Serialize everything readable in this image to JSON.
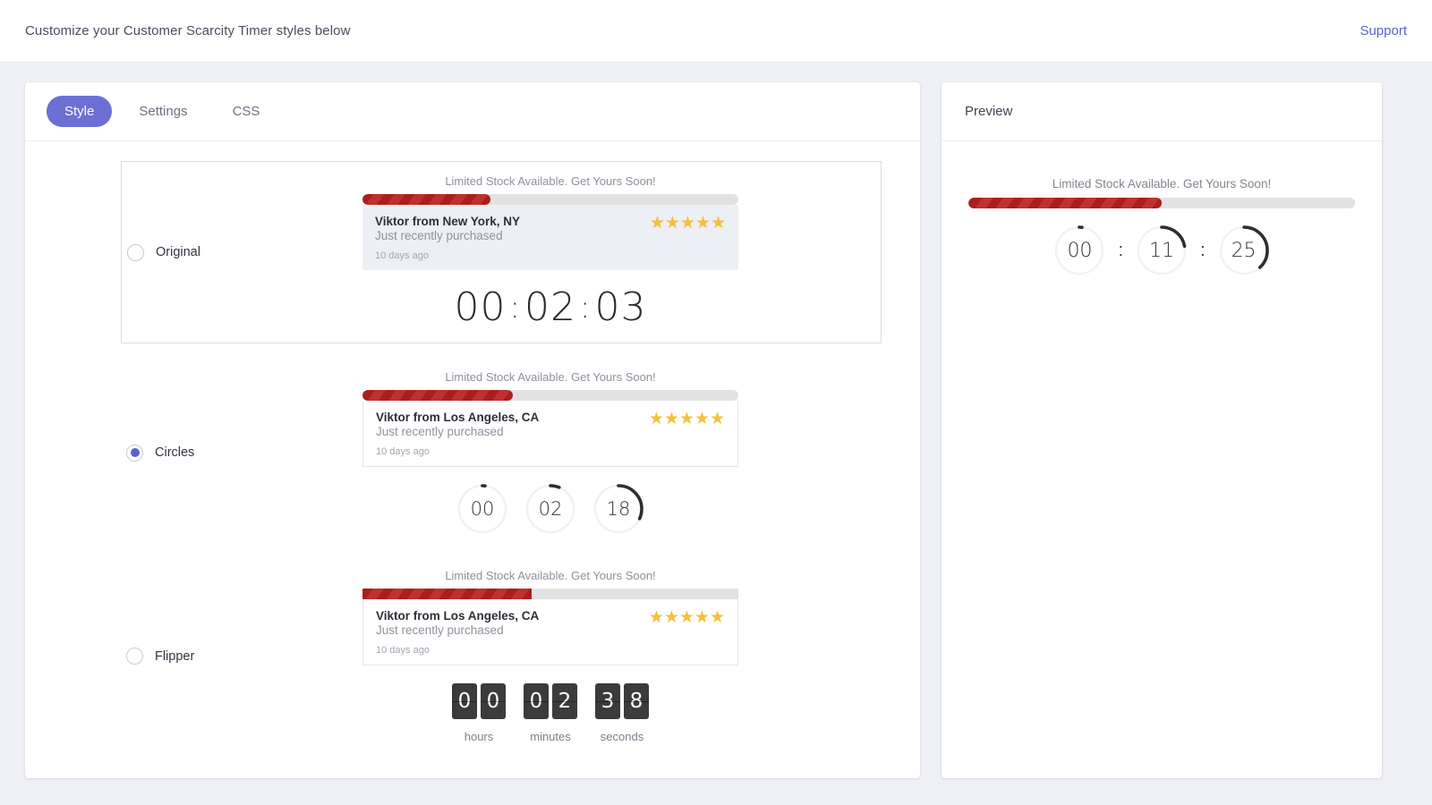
{
  "header": {
    "title": "Customize your Customer Scarcity Timer styles below",
    "support_label": "Support"
  },
  "tabs": [
    {
      "label": "Style",
      "active": true
    },
    {
      "label": "Settings",
      "active": false
    },
    {
      "label": "CSS",
      "active": false
    }
  ],
  "colors": {
    "accent": "#6c6fd4",
    "radio_selected": "#5b61d6",
    "progress_fill": "#aa1e1e",
    "progress_track": "#e2e2e2",
    "star": "#f3c13a",
    "flip_card": "#3b3b3b",
    "page_background": "#eef0f5"
  },
  "styles": [
    {
      "id": "original",
      "radio_label": "Original",
      "selected": false,
      "boxed": true,
      "caption": "Limited Stock Available. Get Yours Soon!",
      "progress_percent": 34,
      "notification": {
        "name": "Viktor from New York, NY",
        "subtitle": "Just recently purchased",
        "time_ago": "10 days ago",
        "stars": "★★★★★",
        "star_count": 5
      },
      "timer": {
        "hours": "00",
        "minutes": "02",
        "seconds": "03",
        "separator": ":"
      }
    },
    {
      "id": "circles",
      "radio_label": "Circles",
      "selected": true,
      "boxed": false,
      "caption": "Limited Stock Available. Get Yours Soon!",
      "progress_percent": 40,
      "notification": {
        "name": "Viktor from Los Angeles, CA",
        "subtitle": "Just recently purchased",
        "time_ago": "10 days ago",
        "stars": "★★★★★",
        "star_count": 5
      },
      "timer": {
        "hours": "00",
        "minutes": "02",
        "seconds": "18"
      },
      "arc_percents": [
        2,
        6,
        32
      ]
    },
    {
      "id": "flipper",
      "radio_label": "Flipper",
      "selected": false,
      "boxed": false,
      "caption": "Limited Stock Available. Get Yours Soon!",
      "progress_percent": 45,
      "notification": {
        "name": "Viktor from Los Angeles, CA",
        "subtitle": "Just recently purchased",
        "time_ago": "10 days ago",
        "stars": "★★★★★",
        "star_count": 5
      },
      "timer": {
        "hours": [
          "0",
          "0"
        ],
        "minutes": [
          "0",
          "2"
        ],
        "seconds": [
          "3",
          "8"
        ],
        "labels": {
          "hours": "hours",
          "minutes": "minutes",
          "seconds": "seconds"
        }
      }
    }
  ],
  "preview": {
    "title": "Preview",
    "caption": "Limited Stock Available. Get Yours Soon!",
    "progress_percent": 50,
    "timer": {
      "hours": "00",
      "minutes": "11",
      "seconds": "25",
      "separator": ":"
    },
    "arc_percents": [
      2,
      22,
      38
    ]
  }
}
